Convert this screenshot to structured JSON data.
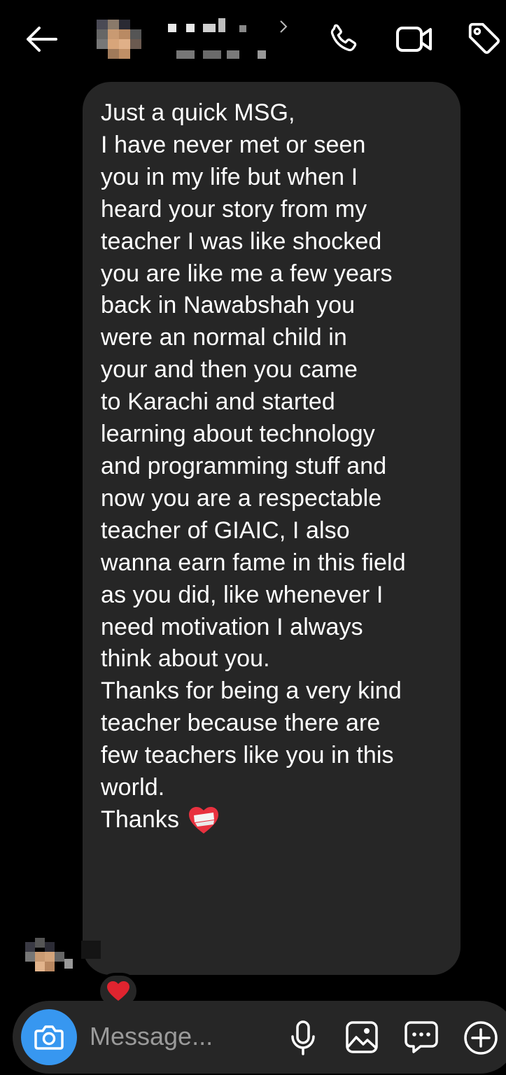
{
  "header": {
    "back_icon": "arrow-left-icon",
    "contact_name": "",
    "contact_username": "",
    "icons": [
      "phone-icon",
      "video-camera-icon",
      "tag-icon"
    ]
  },
  "message": {
    "lines": [
      "Just a quick MSG,",
      "",
      "I have never met or seen",
      "you in my life but when I",
      "heard your story from my",
      "teacher I was like shocked",
      "you are like me a few years",
      "back in Nawabshah you",
      "were an normal child in",
      "your and then you came",
      "to Karachi and started",
      "learning about technology",
      "and programming stuff and",
      "now you are a respectable",
      "teacher of GIAIC, I also",
      "wanna earn fame in this field",
      "as you did, like whenever I",
      "need motivation I always",
      "think about you.",
      "",
      "Thanks for being a very kind",
      "teacher because there are",
      "few teachers like you in this",
      "world.",
      "",
      "",
      "Thanks"
    ],
    "closing_emoji": "mending-heart-emoji",
    "reaction": "red-heart-emoji"
  },
  "composer": {
    "placeholder": "Message...",
    "icons": [
      "camera-icon",
      "microphone-icon",
      "gallery-icon",
      "sticker-chat-icon",
      "plus-icon"
    ]
  },
  "colors": {
    "background": "#000000",
    "bubble": "#262626",
    "accent": "#3797f0",
    "text": "#ffffff",
    "placeholder": "#9a9a9a"
  }
}
